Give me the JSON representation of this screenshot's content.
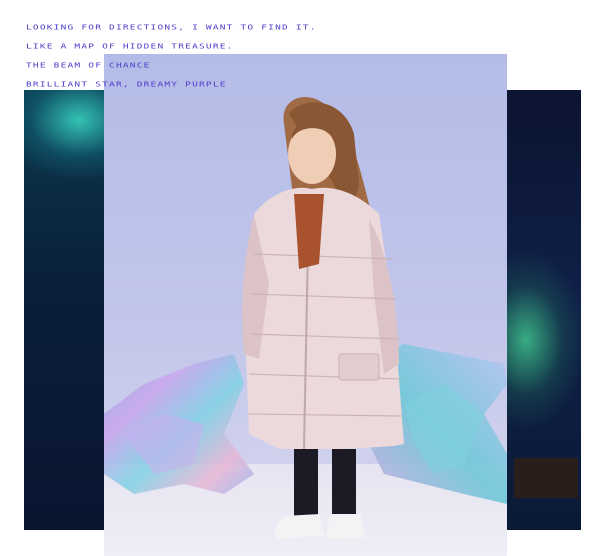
{
  "tagline": {
    "lines": [
      "Looking for directions, I want to find it.",
      "Like a map of hidden treasure.",
      "The beam of chance",
      "Brilliant star, dreamy purple"
    ]
  },
  "colors": {
    "tagline_text": "#4b3fc9",
    "backdrop": "#b3bce8",
    "aurora_green": "#3cdcc8",
    "night_sky": "#0a1530"
  }
}
